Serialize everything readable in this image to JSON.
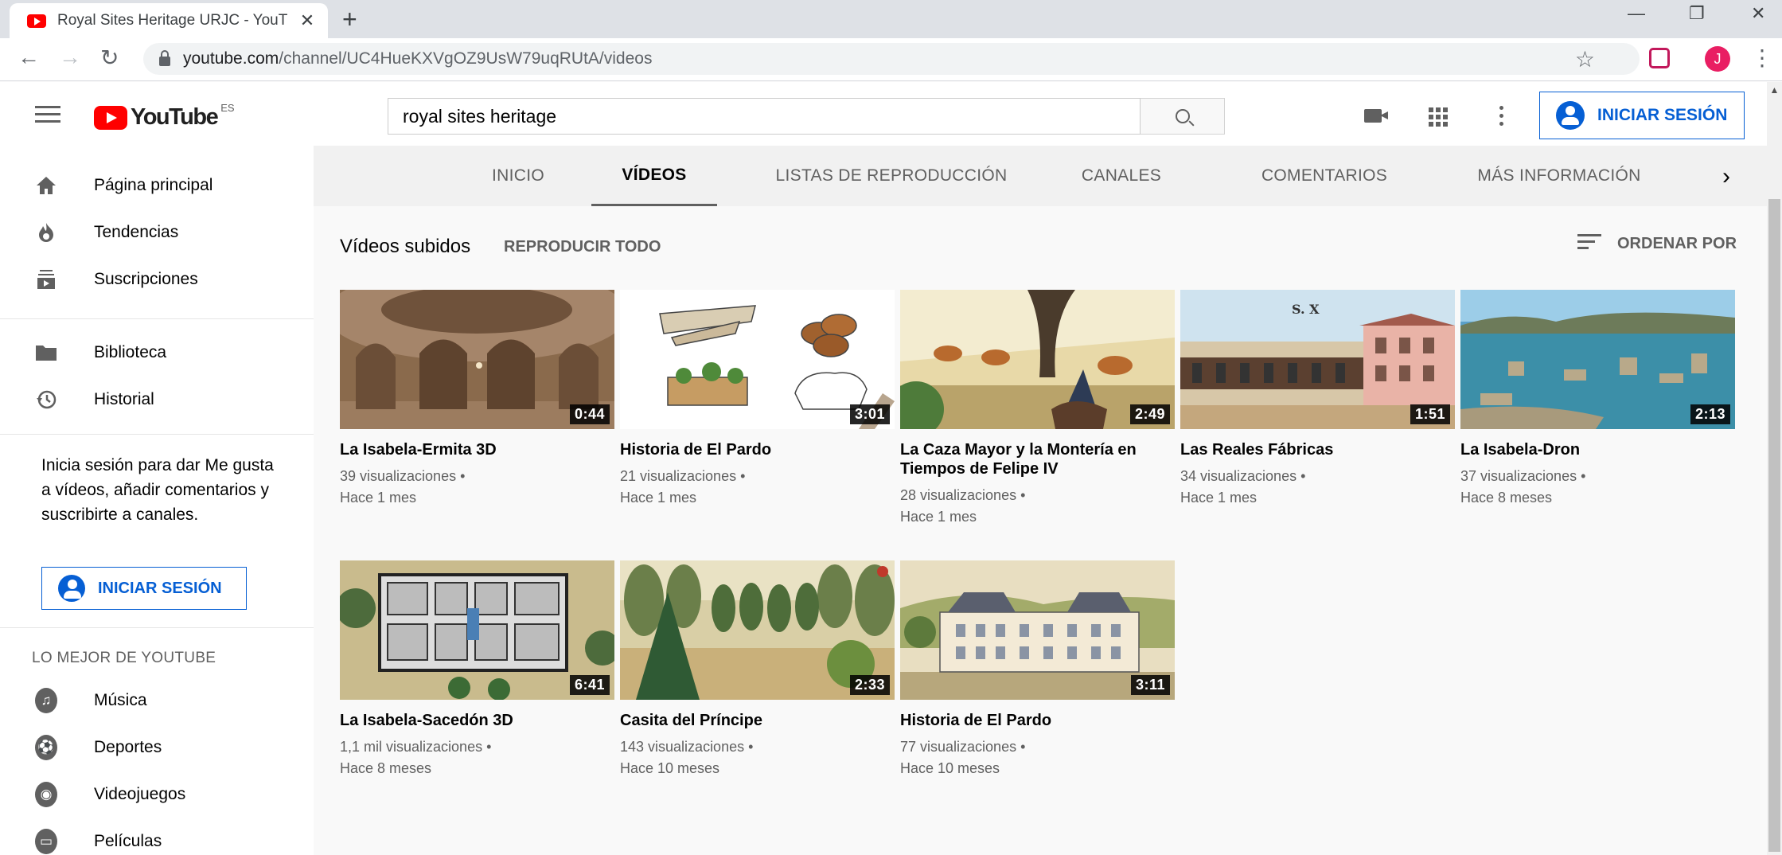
{
  "browser": {
    "tab_title": "Royal Sites Heritage URJC - YouT",
    "tab_close": "✕",
    "new_tab": "+",
    "url_host": "youtube.com",
    "url_path": "/channel/UC4HueKXVgOZ9UsW79uqRUtA/videos",
    "profile_initial": "J",
    "window_controls": [
      "—",
      "❐",
      "✕"
    ]
  },
  "masthead": {
    "logo_text": "YouTube",
    "region": "ES",
    "search_value": "royal sites heritage",
    "signin_label": "INICIAR SESIÓN"
  },
  "sidebar": {
    "items_top": [
      {
        "label": "Página principal",
        "icon": "home-icon"
      },
      {
        "label": "Tendencias",
        "icon": "trending-icon"
      },
      {
        "label": "Suscripciones",
        "icon": "subscriptions-icon"
      }
    ],
    "items_mid": [
      {
        "label": "Biblioteca",
        "icon": "library-icon"
      },
      {
        "label": "Historial",
        "icon": "history-icon"
      }
    ],
    "promo_text": "Inicia sesión para dar Me gusta a vídeos, añadir comentarios y suscribirte a canales.",
    "signin_label": "INICIAR SESIÓN",
    "best_heading": "LO MEJOR DE YOUTUBE",
    "items_best": [
      {
        "label": "Música",
        "icon": "music-icon"
      },
      {
        "label": "Deportes",
        "icon": "sports-icon"
      },
      {
        "label": "Videojuegos",
        "icon": "gaming-icon"
      },
      {
        "label": "Películas",
        "icon": "movies-icon"
      }
    ]
  },
  "channel_tabs": [
    {
      "label": "INICIO"
    },
    {
      "label": "VÍDEOS"
    },
    {
      "label": "LISTAS DE REPRODUCCIÓN"
    },
    {
      "label": "CANALES"
    },
    {
      "label": "COMENTARIOS"
    },
    {
      "label": "MÁS INFORMACIÓN"
    }
  ],
  "content": {
    "section_title": "Vídeos subidos",
    "play_all": "REPRODUCIR TODO",
    "sort_label": "ORDENAR POR",
    "videos": [
      {
        "title": "La Isabela-Ermita 3D",
        "views": "39 visualizaciones •",
        "age": "Hace 1 mes",
        "duration": "0:44"
      },
      {
        "title": "Historia de El Pardo",
        "views": "21 visualizaciones •",
        "age": "Hace 1 mes",
        "duration": "3:01"
      },
      {
        "title": "La Caza Mayor y la Montería en Tiempos de Felipe IV",
        "views": "28 visualizaciones •",
        "age": "Hace 1 mes",
        "duration": "2:49"
      },
      {
        "title": "Las Reales Fábricas",
        "views": "34 visualizaciones •",
        "age": "Hace 1 mes",
        "duration": "1:51"
      },
      {
        "title": "La Isabela-Dron",
        "views": "37 visualizaciones •",
        "age": "Hace 8 meses",
        "duration": "2:13"
      },
      {
        "title": "La Isabela-Sacedón 3D",
        "views": "1,1 mil visualizaciones •",
        "age": "Hace 8 meses",
        "duration": "6:41"
      },
      {
        "title": "Casita del Príncipe",
        "views": "143 visualizaciones •",
        "age": "Hace 10 meses",
        "duration": "2:33"
      },
      {
        "title": "Historia de El Pardo",
        "views": "77 visualizaciones •",
        "age": "Hace 10 meses",
        "duration": "3:11"
      }
    ],
    "thumb4_caption": "S. X"
  },
  "colors": {
    "brand_red": "#ff0000",
    "link_blue": "#065fd4",
    "secondary_text": "#606060"
  }
}
